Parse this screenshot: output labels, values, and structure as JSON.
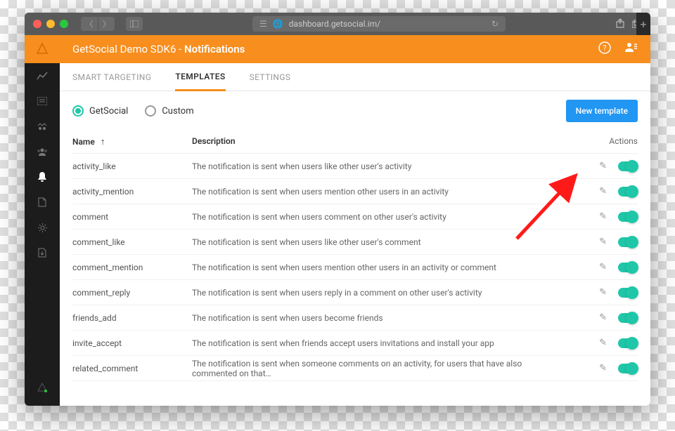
{
  "browser": {
    "url": "dashboard.getsocial.im/"
  },
  "header": {
    "breadcrumb": "GetSocial Demo SDK6 -",
    "title": "Notifications"
  },
  "tabs": [
    {
      "label": "SMART TARGETING",
      "active": false
    },
    {
      "label": "TEMPLATES",
      "active": true
    },
    {
      "label": "SETTINGS",
      "active": false
    }
  ],
  "filter": {
    "getsocial": "GetSocial",
    "custom": "Custom"
  },
  "new_button": "New template",
  "columns": {
    "name": "Name",
    "description": "Description",
    "actions": "Actions"
  },
  "rows": [
    {
      "name": "activity_like",
      "description": "The notification is sent when users like other user's activity"
    },
    {
      "name": "activity_mention",
      "description": "The notification is sent when users mention other users in an activity"
    },
    {
      "name": "comment",
      "description": "The notification is sent when users comment on other user's activity"
    },
    {
      "name": "comment_like",
      "description": "The notification is sent when users like other user's comment"
    },
    {
      "name": "comment_mention",
      "description": "The notification is sent when users mention other users in an activity or comment"
    },
    {
      "name": "comment_reply",
      "description": "The notification is sent when users reply in a comment on other user's activity"
    },
    {
      "name": "friends_add",
      "description": "The notification is sent when users become friends"
    },
    {
      "name": "invite_accept",
      "description": "The notification is sent when friends accept users invitations and install your app"
    },
    {
      "name": "related_comment",
      "description": "The notification is sent when someone comments on an activity, for users that have also commented on that…"
    }
  ]
}
